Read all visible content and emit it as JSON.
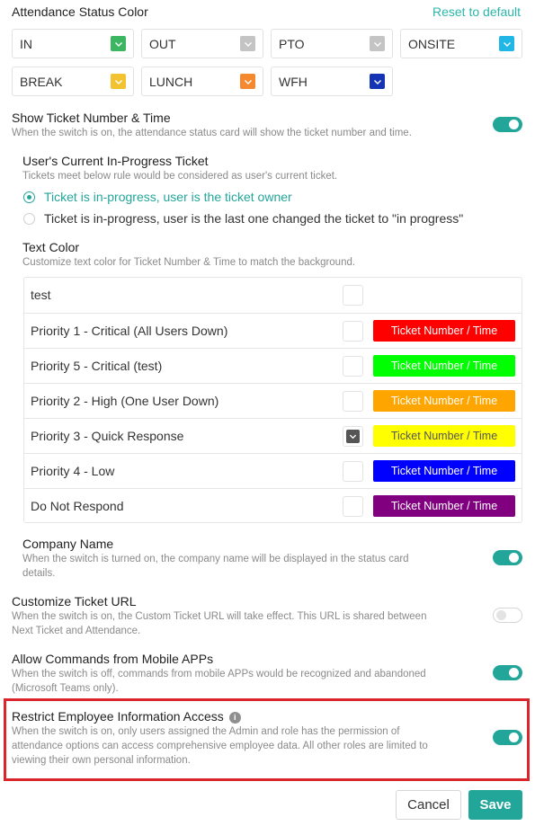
{
  "header": {
    "title": "Attendance Status Color",
    "reset_label": "Reset to default"
  },
  "statuses": [
    {
      "label": "IN",
      "color": "#3cb660"
    },
    {
      "label": "OUT",
      "color": "#c4c4c4"
    },
    {
      "label": "PTO",
      "color": "#c4c4c4"
    },
    {
      "label": "ONSITE",
      "color": "#20b7e6"
    },
    {
      "label": "BREAK",
      "color": "#f2c230"
    },
    {
      "label": "LUNCH",
      "color": "#f4892f"
    },
    {
      "label": "WFH",
      "color": "#1434b4"
    }
  ],
  "show_ticket": {
    "title": "Show Ticket Number & Time",
    "desc": "When the switch is on, the attendance status card will show the ticket number and time.",
    "enabled": true
  },
  "current_ticket": {
    "title": "User's Current In-Progress Ticket",
    "desc": "Tickets meet below rule would be considered as user's current ticket.",
    "options": [
      {
        "label": "Ticket is in-progress, user is the ticket owner",
        "selected": true
      },
      {
        "label": "Ticket is in-progress, user is the last one changed the ticket to \"in progress\"",
        "selected": false
      }
    ]
  },
  "text_color": {
    "title": "Text Color",
    "desc": "Customize text color for Ticket Number & Time to match the background.",
    "sample_text": "Ticket Number / Time",
    "rows": [
      {
        "label": "test",
        "checked": false,
        "bg": "",
        "fg": ""
      },
      {
        "label": "Priority 1 - Critical (All Users Down)",
        "checked": false,
        "bg": "#ff0000",
        "fg": "#ffffff"
      },
      {
        "label": "Priority 5 - Critical (test)",
        "checked": false,
        "bg": "#00ff00",
        "fg": "#ffffff"
      },
      {
        "label": "Priority 2 - High (One User Down)",
        "checked": false,
        "bg": "#ffa500",
        "fg": "#ffffff"
      },
      {
        "label": "Priority 3 - Quick Response",
        "checked": true,
        "bg": "#ffff00",
        "fg": "#555555"
      },
      {
        "label": "Priority 4 - Low",
        "checked": false,
        "bg": "#0000ff",
        "fg": "#ffffff"
      },
      {
        "label": "Do Not Respond",
        "checked": false,
        "bg": "#800080",
        "fg": "#ffffff"
      }
    ]
  },
  "company_name": {
    "title": "Company Name",
    "desc1": "When the switch is turned on, the company name will be displayed in the status card",
    "desc2": "details.",
    "enabled": true
  },
  "custom_url": {
    "title": "Customize Ticket URL",
    "desc1": "When the switch is on, the Custom Ticket URL will take effect. This URL is shared between",
    "desc2": "Next Ticket and Attendance.",
    "enabled": false
  },
  "mobile_commands": {
    "title": "Allow Commands from Mobile APPs",
    "desc1": "When the switch is off, commands from mobile APPs would be recognized and abandoned",
    "desc2": "(Microsoft Teams only).",
    "enabled": true
  },
  "restrict_access": {
    "title": "Restrict Employee Information Access",
    "desc1": "When the switch is on, only users assigned the Admin and role has the permission of",
    "desc2": "attendance options can access comprehensive employee data. All other roles are limited to",
    "desc3": "viewing their own personal information.",
    "enabled": true
  },
  "footer": {
    "cancel_label": "Cancel",
    "save_label": "Save"
  },
  "colors": {
    "accent": "#23a69a",
    "highlight_border": "#d9252b"
  }
}
